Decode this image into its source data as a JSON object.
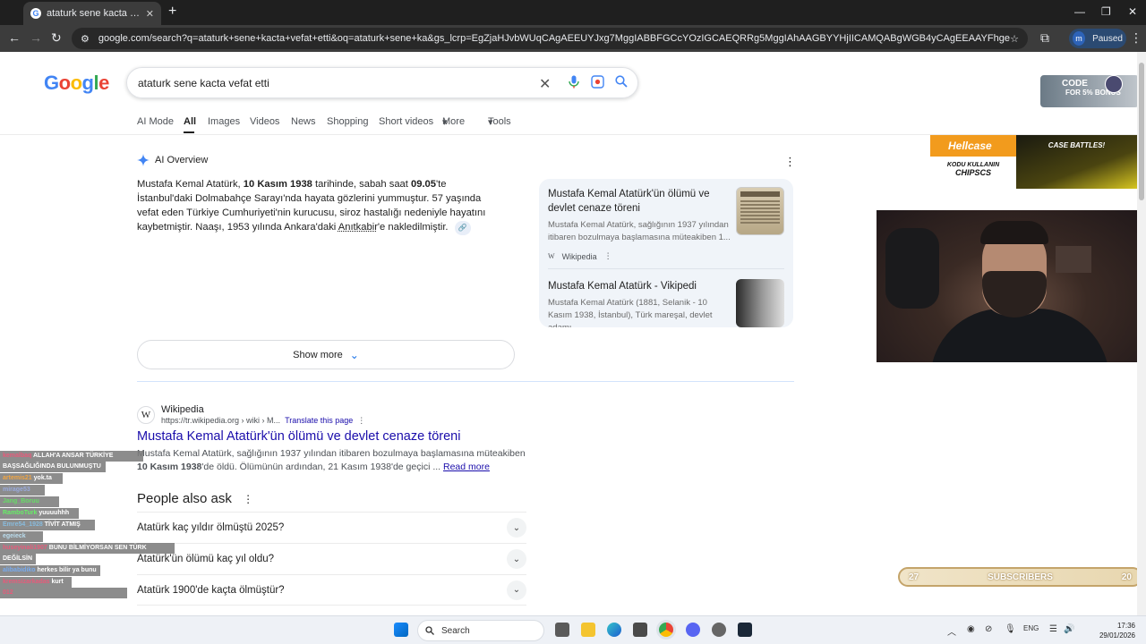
{
  "browser": {
    "tab_title": "ataturk sene kacta vefat etti - G",
    "tab_close": "✕",
    "new_tab": "+",
    "url": "google.com/search?q=ataturk+sene+kacta+vefat+etti&oq=ataturk+sene+ka&gs_lcrp=EgZjaHJvbWUqCAgAEEUYJxg7MggIABBFGCcYOzIGCAEQRRg5MggIAhAAGBYYHjIICAMQABgWGB4yCAgEEAAYFhgeMggIBRAAGBYYHjIICAYQABgWGB4yCAgH...",
    "profile_initial": "m",
    "profile_status": "Paused"
  },
  "google": {
    "logo": [
      "G",
      "o",
      "o",
      "g",
      "l",
      "e"
    ],
    "logo_colors": [
      "#4285F4",
      "#EA4335",
      "#FBBC05",
      "#4285F4",
      "#34A853",
      "#EA4335"
    ],
    "query": "ataturk sene kacta vefat etti",
    "tabs": [
      "AI Mode",
      "All",
      "Images",
      "Videos",
      "News",
      "Shopping",
      "Short videos",
      "More",
      "Tools"
    ],
    "active_tab": "All",
    "more_caret": "▾",
    "tools_caret": "▾"
  },
  "ai_overview": {
    "title": "AI Overview",
    "menu": "⋮",
    "text_1": "Mustafa Kemal Atatürk, ",
    "text_b1": "10 Kasım 1938",
    "text_2": " tarihinde, sabah saat ",
    "text_b2": "09.05",
    "text_3": "'te İstanbul'daki Dolmabahçe Sarayı'nda hayata gözlerini yummuştur. 57 yaşında vefat eden Türkiye Cumhuriyeti'nin kurucusu, siroz hastalığı nedeniyle hayatını kaybetmiştir. Naaşı, 1953 yılında Ankara'daki ",
    "text_link": "Anıtkabir",
    "text_4": "'e nakledilmiştir.",
    "link_icon": "🔗",
    "sources": [
      {
        "title": "Mustafa Kemal Atatürk'ün ölümü ve devlet cenaze töreni",
        "snippet": "Mustafa Kemal Atatürk, sağlığının 1937 yılından itibaren bozulmaya başlamasına müteakiben 1...",
        "source": "Wikipedia",
        "source_icon": "W",
        "menu": "⋮"
      },
      {
        "title": "Mustafa Kemal Atatürk - Vikipedi",
        "snippet": "Mustafa Kemal Atatürk (1881, Selanik - 10 Kasım 1938, İstanbul), Türk mareşal, devlet adamı,..."
      }
    ],
    "show_more": "Show more",
    "show_more_icon": "⌄"
  },
  "result": {
    "site_icon": "W",
    "site": "Wikipedia",
    "url": "https://tr.wikipedia.org › wiki › M...",
    "translate": "Translate this page",
    "menu": "⋮",
    "title": "Mustafa Kemal Atatürk'ün ölümü ve devlet cenaze töreni",
    "snippet_1": "Mustafa Kemal Atatürk, sağlığının 1937 yılından itibaren bozulmaya başlamasına müteakiben ",
    "snippet_b": "10 Kasım 1938",
    "snippet_2": "'de öldü. Ölümünün ardından, 21 Kasım 1938'de geçici ... ",
    "read_more": "Read more"
  },
  "people_also_ask": {
    "title": "People also ask",
    "menu": "⋮",
    "questions": [
      "Atatürk kaç yıldır ölmüştü 2025?",
      "Atatürk'ün ölümü kaç yıl oldu?",
      "Atatürk 1900'de kaçta ölmüştür?"
    ]
  },
  "overlays": {
    "code_banner_1": "CODE",
    "code_banner_2": "FOR 5% BONUS",
    "hellcase_logo": "Hellcase",
    "hellcase_code_1": "KODU KULLANIN",
    "hellcase_code_2": "CHIPSCS",
    "hellcase_battle": "CASE BATTLES!",
    "subs_left": "27",
    "subs_label": "SUBSCRIBERS",
    "subs_right": "20"
  },
  "chat": [
    {
      "user": "kemalbaq",
      "msg": "ALLAH'A ANSAR TÜRKİYE"
    },
    {
      "user": "",
      "msg": "BAŞSAĞLIĞINDA BULUNMUŞTU"
    },
    {
      "user": "artemis21",
      "msg": "yok.ta"
    },
    {
      "user": "mirage53",
      "msg": ""
    },
    {
      "user": "Jang_Boruu",
      "msg": ""
    },
    {
      "user": "RamboTurk",
      "msg": "yuuuuhhh"
    },
    {
      "user": "Emre54_1928",
      "msg": "TİVİT ATMIŞ"
    },
    {
      "user": "egeieck",
      "msg": ""
    },
    {
      "user": "huseyinali1907",
      "msg": "BUNU BİLMİYORSAN SEN TÜRK"
    },
    {
      "user": "",
      "msg": "DEĞİLSİN"
    },
    {
      "user": "alibabidiko",
      "msg": "herkes bilir ya bunu"
    },
    {
      "user": "kremsizarkadas",
      "msg": "kurt"
    },
    {
      "user": "012",
      "msg": ""
    }
  ],
  "taskbar": {
    "search": "Search",
    "lang": "ENG",
    "time": "17:36",
    "date": "29/01/2026"
  }
}
